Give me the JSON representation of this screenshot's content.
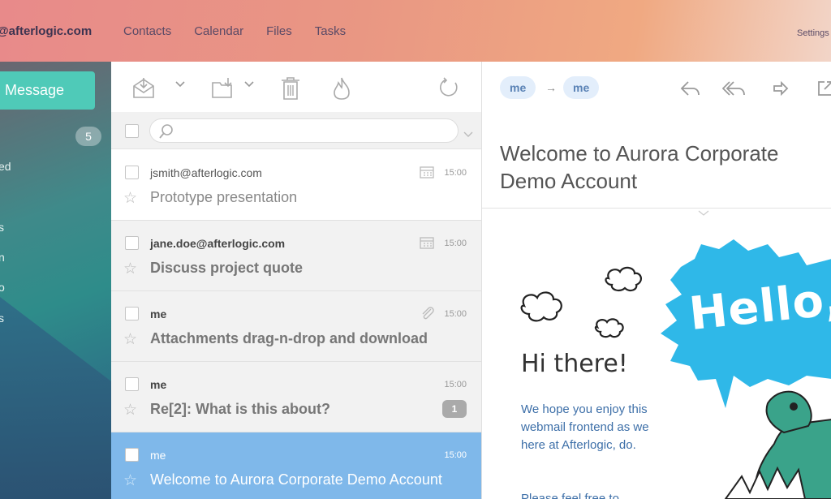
{
  "header": {
    "account": "@afterlogic.com",
    "nav": [
      "Contacts",
      "Calendar",
      "Files",
      "Tasks"
    ],
    "settings": "Settings"
  },
  "sidebar": {
    "new_message_label": "Message",
    "inbox_count": "5",
    "folder_fragments": [
      "ed",
      "s",
      "n",
      "o",
      "s"
    ]
  },
  "toolbar": {
    "icons": [
      "move-to-folder-icon",
      "dropdown-icon",
      "download-icon",
      "dropdown-icon",
      "trash-icon",
      "spam-icon",
      "refresh-icon"
    ]
  },
  "search": {
    "placeholder": ""
  },
  "messages": [
    {
      "from": "jsmith@afterlogic.com",
      "subject": "Prototype presentation",
      "time": "15:00",
      "icon": "calendar-icon",
      "unread": false,
      "selected": false
    },
    {
      "from": "jane.doe@afterlogic.com",
      "subject": "Discuss project quote",
      "time": "15:00",
      "icon": "calendar-icon",
      "unread": true,
      "selected": false
    },
    {
      "from": "me",
      "subject": "Attachments drag-n-drop and download",
      "time": "15:00",
      "icon": "paperclip-icon",
      "unread": true,
      "selected": false
    },
    {
      "from": "me",
      "subject": "Re[2]: What is this about?",
      "time": "15:00",
      "badge": "1",
      "unread": true,
      "selected": false
    },
    {
      "from": "me",
      "subject": "Welcome to Aurora Corporate Demo Account",
      "time": "15:00",
      "unread": false,
      "selected": true
    }
  ],
  "preview": {
    "from_chip": "me",
    "to_chip": "me",
    "arrow": "→",
    "title": "Welcome to Aurora Corporate Demo Account",
    "greeting": "Hi there!",
    "body": "We hope you enjoy this webmail frontend as we here at Afterlogic, do.",
    "body_more": "Please feel free to",
    "illustration_text": "Hello, W"
  },
  "colors": {
    "accent_new": "#4fcab8",
    "selected_row": "#7fb8ea",
    "chip_bg": "#e3eefb",
    "hello_bubble": "#2fb8e8",
    "croc": "#3aa38a"
  }
}
